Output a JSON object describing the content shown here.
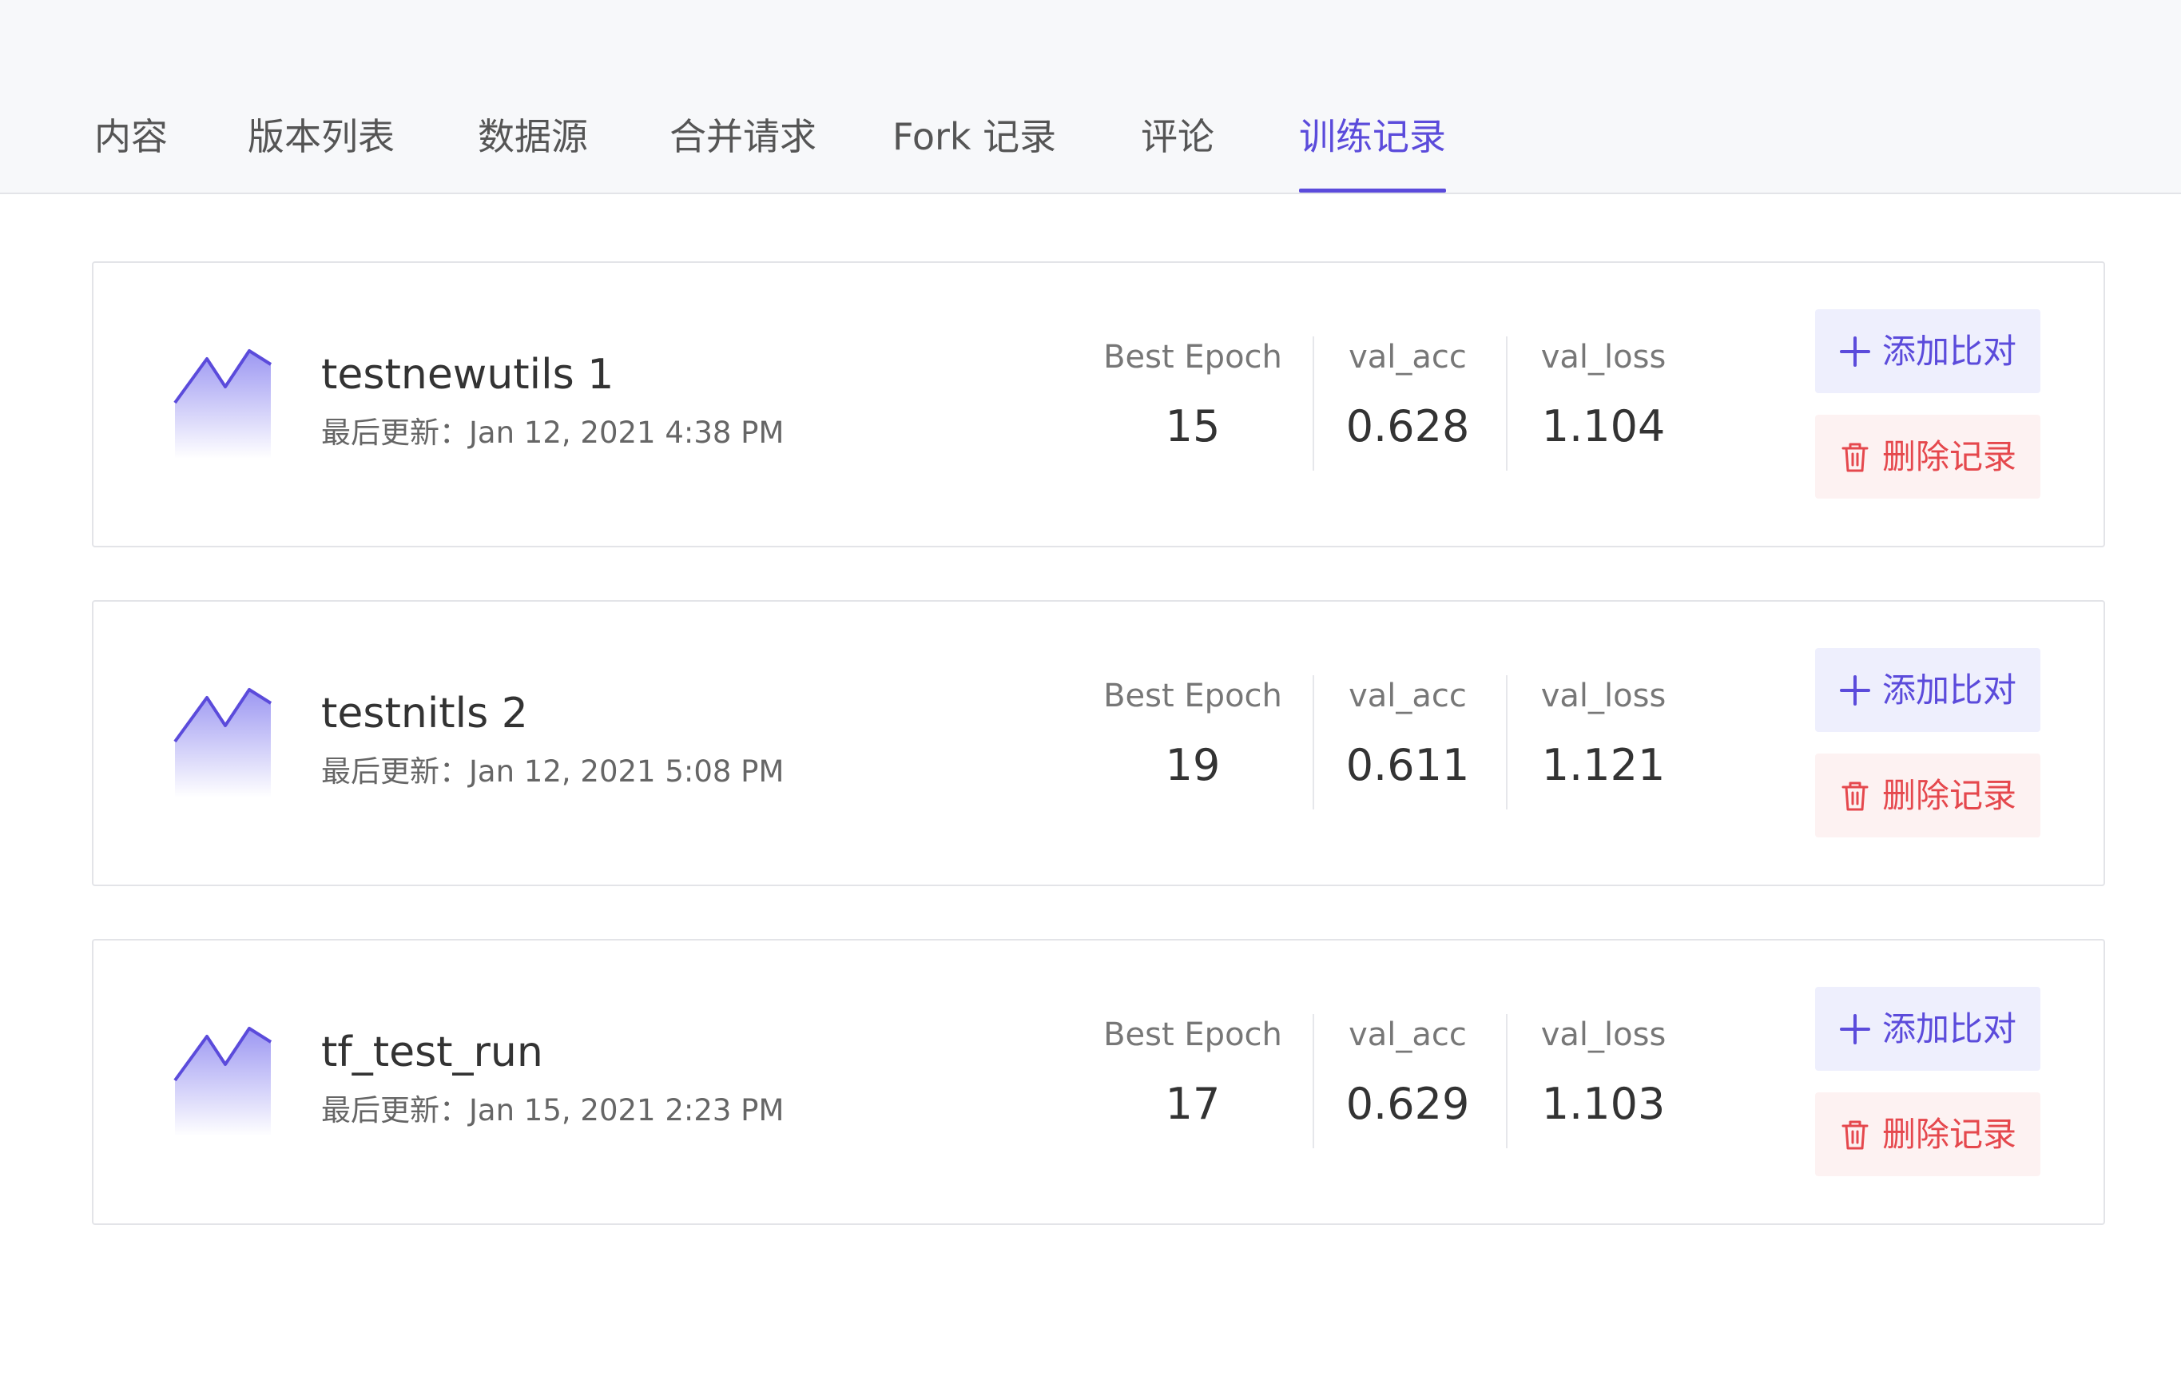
{
  "tabs": [
    {
      "label": "内容",
      "active": false
    },
    {
      "label": "版本列表",
      "active": false
    },
    {
      "label": "数据源",
      "active": false
    },
    {
      "label": "合并请求",
      "active": false
    },
    {
      "label": "Fork 记录",
      "active": false
    },
    {
      "label": "评论",
      "active": false
    },
    {
      "label": "训练记录",
      "active": true
    }
  ],
  "metric_labels": {
    "best_epoch": "Best Epoch",
    "val_acc": "val_acc",
    "val_loss": "val_loss"
  },
  "actions": {
    "compare_label": "添加比对",
    "delete_label": "删除记录"
  },
  "runs": [
    {
      "name": "testnewutils 1",
      "updated": "最后更新：Jan 12, 2021 4:38 PM",
      "best_epoch": "15",
      "val_acc": "0.628",
      "val_loss": "1.104"
    },
    {
      "name": "testnitls 2",
      "updated": "最后更新：Jan 12, 2021 5:08 PM",
      "best_epoch": "19",
      "val_acc": "0.611",
      "val_loss": "1.121"
    },
    {
      "name": "tf_test_run",
      "updated": "最后更新：Jan 15, 2021 2:23 PM",
      "best_epoch": "17",
      "val_acc": "0.629",
      "val_loss": "1.103"
    }
  ],
  "colors": {
    "accent": "#5b4bdb",
    "danger": "#e5484d",
    "compare_bg": "#eeeffd",
    "delete_bg": "#fdf2f2"
  },
  "icons": {
    "run": "area-chart-icon",
    "compare": "plus-icon",
    "delete": "trash-icon"
  }
}
